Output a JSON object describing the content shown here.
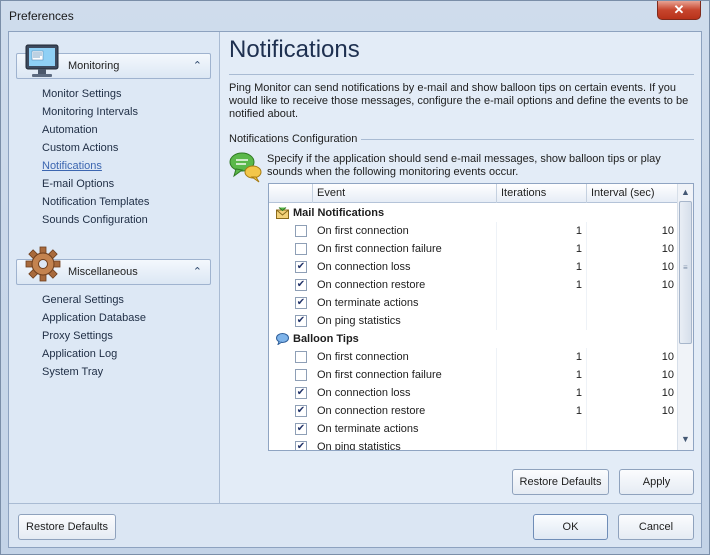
{
  "window": {
    "title": "Preferences",
    "close_glyph": "✕"
  },
  "nav": {
    "groups": [
      {
        "title": "Monitoring",
        "icon": "monitor-icon",
        "items": [
          "Monitor Settings",
          "Monitoring Intervals",
          "Automation",
          "Custom Actions",
          "Notifications",
          "E-mail Options",
          "Notification Templates",
          "Sounds Configuration"
        ]
      },
      {
        "title": "Miscellaneous",
        "icon": "gear-icon",
        "items": [
          "General Settings",
          "Application Database",
          "Proxy Settings",
          "Application Log",
          "System Tray"
        ]
      }
    ],
    "collapse_glyph": "⌃",
    "selected": "Notifications"
  },
  "page": {
    "heading": "Notifications",
    "intro": "Ping Monitor can send notifications by e-mail and show balloon tips on certain events. If you would like to receive those messages, configure the e-mail options and define the events to be notified about.",
    "section_label": "Notifications Configuration",
    "config_desc": "Specify if the application should send e-mail messages, show balloon tips or play sounds when the following monitoring events occur."
  },
  "grid": {
    "columns": {
      "event": "Event",
      "iterations": "Iterations",
      "interval": "Interval (sec)"
    },
    "groups": [
      {
        "name": "Mail Notifications",
        "icon": "mail-icon",
        "rows": [
          {
            "event": "On first connection",
            "checked": false,
            "iterations": "1",
            "interval": "10"
          },
          {
            "event": "On first connection failure",
            "checked": false,
            "iterations": "1",
            "interval": "10"
          },
          {
            "event": "On connection loss",
            "checked": true,
            "iterations": "1",
            "interval": "10"
          },
          {
            "event": "On connection restore",
            "checked": true,
            "iterations": "1",
            "interval": "10"
          },
          {
            "event": "On terminate actions",
            "checked": true,
            "iterations": "",
            "interval": ""
          },
          {
            "event": "On ping statistics",
            "checked": true,
            "iterations": "",
            "interval": ""
          }
        ]
      },
      {
        "name": "Balloon Tips",
        "icon": "balloon-tip-icon",
        "rows": [
          {
            "event": "On first connection",
            "checked": false,
            "iterations": "1",
            "interval": "10"
          },
          {
            "event": "On first connection failure",
            "checked": false,
            "iterations": "1",
            "interval": "10"
          },
          {
            "event": "On connection loss",
            "checked": true,
            "iterations": "1",
            "interval": "10"
          },
          {
            "event": "On connection restore",
            "checked": true,
            "iterations": "1",
            "interval": "10"
          },
          {
            "event": "On terminate actions",
            "checked": true,
            "iterations": "",
            "interval": ""
          },
          {
            "event": "On ping statistics",
            "checked": true,
            "iterations": "",
            "interval": ""
          }
        ]
      }
    ],
    "check_glyph": "✔",
    "scroll_up_glyph": "▲",
    "scroll_down_glyph": "▼"
  },
  "buttons": {
    "page_restore_defaults": "Restore Defaults",
    "apply": "Apply",
    "footer_restore_defaults": "Restore Defaults",
    "ok": "OK",
    "cancel": "Cancel"
  }
}
